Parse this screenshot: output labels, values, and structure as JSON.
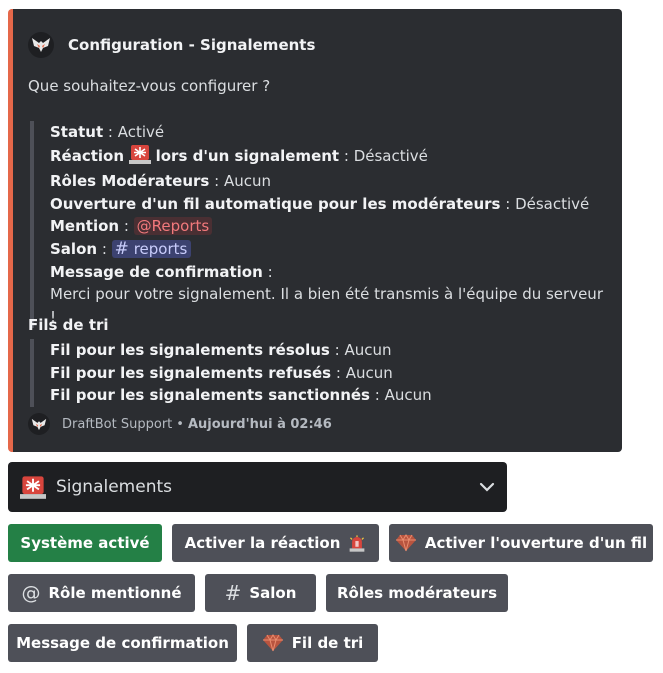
{
  "embed": {
    "author": "Configuration - Signalements",
    "description": "Que souhaitez-vous configurer ?",
    "fields": {
      "statut_label": "Statut",
      "statut_value": "Activé",
      "reaction_label_a": "Réaction",
      "reaction_label_b": "lors d'un signalement",
      "reaction_value": "Désactivé",
      "roles_label": "Rôles Modérateurs",
      "roles_value": "Aucun",
      "thread_label": "Ouverture d'un fil automatique pour les modérateurs",
      "thread_value": "Désactivé",
      "mention_label": "Mention",
      "mention_value": "@Reports",
      "salon_label": "Salon",
      "salon_value": "reports",
      "confirm_label": "Message de confirmation",
      "confirm_value": "Merci pour votre signalement. Il a bien été transmis à l'équipe du serveur !"
    },
    "sort_title": "Fils de tri",
    "sort_fields": {
      "resolved_label": "Fil pour les signalements résolus",
      "resolved_value": "Aucun",
      "refused_label": "Fil pour les signalements refusés",
      "refused_value": "Aucun",
      "sanctioned_label": "Fil pour les signalements sanctionnés",
      "sanctioned_value": "Aucun"
    },
    "footer_name": "DraftBot Support",
    "footer_time": "Aujourd'hui à 02:46"
  },
  "select": {
    "label": "Signalements"
  },
  "buttons": {
    "system": "Système activé",
    "reaction": "Activer la réaction",
    "thread": "Activer l'ouverture d'un fil",
    "role": "Rôle mentionné",
    "salon": "Salon",
    "moderators": "Rôles modérateurs",
    "confirm": "Message de confirmation",
    "sort": "Fil de tri"
  },
  "colors": {
    "embed_accent": "#e5684a",
    "success": "#248046",
    "secondary": "#4e5058"
  },
  "icons": [
    "draftbot-logo-icon",
    "siren-icon",
    "gem-icon",
    "at-icon",
    "hash-icon",
    "chevron-down-icon"
  ]
}
